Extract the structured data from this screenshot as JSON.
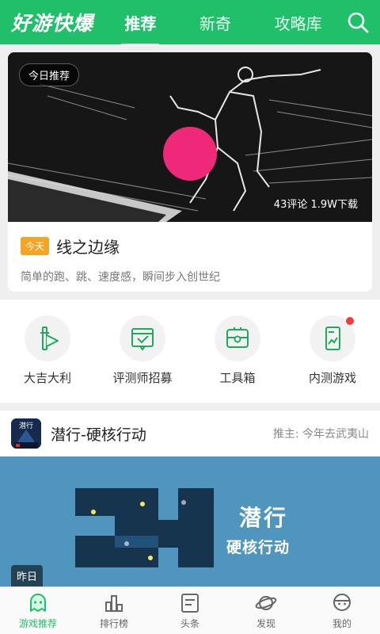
{
  "header": {
    "logo": "好游快爆",
    "tabs": [
      "推荐",
      "新奇",
      "攻略库"
    ],
    "active_tab": 0
  },
  "feature": {
    "badge": "今日推荐",
    "stats": "43评论  1.9W下载",
    "day_tag": "今天",
    "title": "线之边缘",
    "description": "简单的跑、跳、速度感，瞬间步入创世纪"
  },
  "quick_entries": [
    {
      "label": "大吉大利",
      "icon": "gift-play-icon"
    },
    {
      "label": "评测师招募",
      "icon": "review-icon"
    },
    {
      "label": "工具箱",
      "icon": "toolbox-icon"
    },
    {
      "label": "内测游戏",
      "icon": "beta-phone-icon",
      "red_dot": true
    }
  ],
  "game_card": {
    "title": "潜行-硬核行动",
    "recommender": "推主: 今年去武夷山",
    "banner_line1": "潜行",
    "banner_line2": "硬核行动",
    "icon_text": "潜行",
    "day_label": "昨日"
  },
  "bottom_nav": [
    {
      "label": "游戏推荐",
      "icon": "ghost-icon",
      "active": true
    },
    {
      "label": "排行榜",
      "icon": "ranking-icon"
    },
    {
      "label": "头条",
      "icon": "news-icon"
    },
    {
      "label": "发现",
      "icon": "planet-icon"
    },
    {
      "label": "我的",
      "icon": "profile-icon"
    }
  ],
  "colors": {
    "brand_green": "#20c06a",
    "tag_orange": "#f4a524",
    "dot_red": "#f23b3b"
  }
}
